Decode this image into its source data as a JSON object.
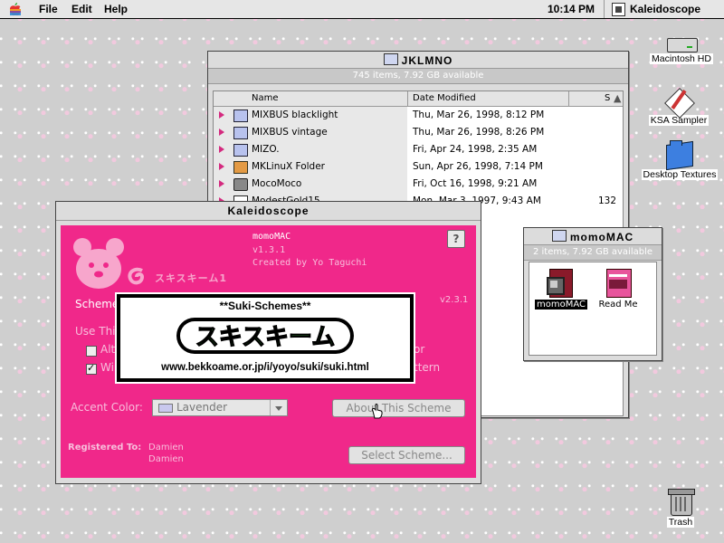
{
  "menubar": {
    "menus": [
      "File",
      "Edit",
      "Help"
    ],
    "clock": "10:14 PM",
    "active_app": "Kaleidoscope"
  },
  "desktop_icons": {
    "hd": "Macintosh HD",
    "ksa": "KSA Sampler",
    "textures": "Desktop Textures",
    "trash": "Trash"
  },
  "finder": {
    "title": "JKLMNO",
    "info": "745 items, 7.92 GB available",
    "columns": {
      "name": "Name",
      "date": "Date Modified",
      "size": "S"
    },
    "rows": [
      {
        "name": "MIXBUS blacklight",
        "date": "Thu, Mar 26, 1998, 8:12 PM",
        "size": "",
        "icon": "folder-icon"
      },
      {
        "name": "MIXBUS vintage",
        "date": "Thu, Mar 26, 1998, 8:26 PM",
        "size": "",
        "icon": "folder-icon"
      },
      {
        "name": "MIZO.",
        "date": "Fri, Apr 24, 1998, 2:35 AM",
        "size": "",
        "icon": "folder-icon"
      },
      {
        "name": "MKLinuX Folder",
        "date": "Sun, Apr 26, 1998, 7:14 PM",
        "size": "",
        "icon": "linux-folder-icon"
      },
      {
        "name": "MocoMoco",
        "date": "Fri, Oct 16, 1998, 9:21 AM",
        "size": "",
        "icon": "disk-icon"
      },
      {
        "name": "ModestGold15",
        "date": "Mon, Mar 3, 1997, 9:43 AM",
        "size": "132",
        "icon": "document-icon"
      },
      {
        "name": "",
        "date": "98, 7:42 PM",
        "size": "",
        "icon": ""
      },
      {
        "name": "",
        "date": "997, 10",
        "size": "",
        "icon": ""
      },
      {
        "name": "",
        "date": "956, 5:29",
        "size": "",
        "icon": ""
      },
      {
        "name": "",
        "date": "956, 5:29",
        "size": "",
        "icon": ""
      },
      {
        "name": "",
        "date": "98, 12:3",
        "size": "",
        "icon": ""
      },
      {
        "name": "",
        "date": "98, 9:16",
        "size": "",
        "icon": ""
      },
      {
        "name": "",
        "date": "98, 9:19",
        "size": "",
        "icon": ""
      },
      {
        "name": "",
        "date": "98, 10:3",
        "size": "",
        "icon": ""
      },
      {
        "name": "",
        "date": "99, 9:10",
        "size": "",
        "icon": ""
      },
      {
        "name": "",
        "date": "99, 11:17 AM",
        "size": "",
        "icon": ""
      },
      {
        "name": "",
        "date": "98, 5:03 PM",
        "size": "",
        "icon": ""
      }
    ]
  },
  "momo": {
    "title": "momoMAC",
    "info": "2 items, 7.92 GB available",
    "items": [
      "momoMAC",
      "Read Me"
    ]
  },
  "kaleidoscope": {
    "title": "Kaleidoscope",
    "scheme_name": "momoMAC",
    "scheme_version": "v1.3.1",
    "scheme_author": "Created by Yo Taguchi",
    "app_version": "v2.3.1",
    "logo_text": "スキスキーム1",
    "scheme_label": "Scheme",
    "use_this_label": "Use This",
    "check1_label": "Alte",
    "check1_tail": "or",
    "check2_label": "Win",
    "check2_tail": "ttern",
    "accent_label": "Accent Color:",
    "accent_value": "Lavender",
    "about_button": "About This Scheme",
    "select_button": "Select Scheme...",
    "registered_label": "Registered To:",
    "registered_name": "Damien",
    "registered_org": "Damien",
    "help_glyph": "?"
  },
  "banner": {
    "heading": "**Suki-Schemes**",
    "logo": "スキスキーム",
    "url": "www.bekkoame.or.jp/i/yoyo/suki/suki.html"
  }
}
